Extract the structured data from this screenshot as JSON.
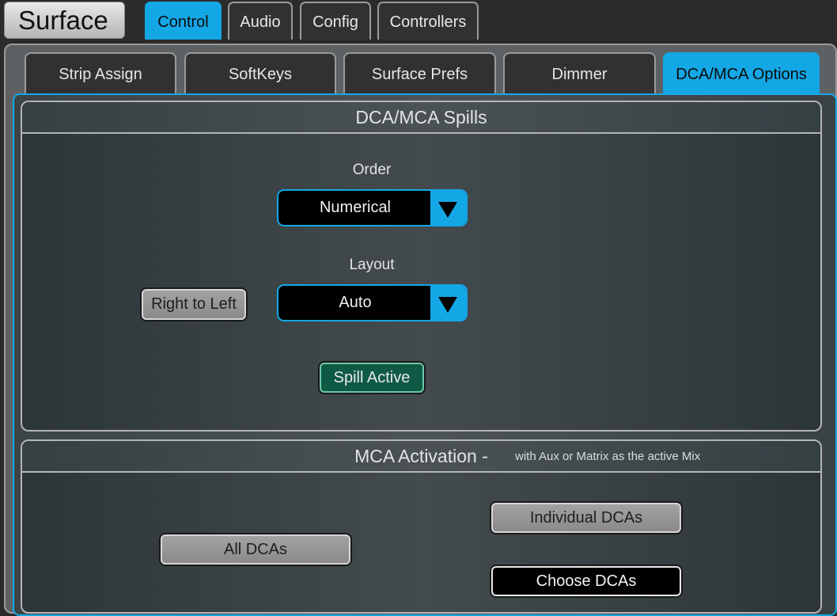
{
  "app": {
    "title": "Surface"
  },
  "top_tabs": [
    {
      "label": "Control",
      "active": true
    },
    {
      "label": "Audio",
      "active": false
    },
    {
      "label": "Config",
      "active": false
    },
    {
      "label": "Controllers",
      "active": false
    }
  ],
  "sub_tabs": [
    {
      "label": "Strip Assign",
      "active": false
    },
    {
      "label": "SoftKeys",
      "active": false
    },
    {
      "label": "Surface Prefs",
      "active": false
    },
    {
      "label": "Dimmer",
      "active": false
    },
    {
      "label": "DCA/MCA Options",
      "active": true
    }
  ],
  "spills": {
    "title": "DCA/MCA Spills",
    "order_label": "Order",
    "order_value": "Numerical",
    "layout_label": "Layout",
    "layout_value": "Auto",
    "direction_button": "Right to Left",
    "spill_active_button": "Spill Active"
  },
  "activation": {
    "title": "MCA Activation -",
    "subtitle": "with Aux or Matrix as the active Mix",
    "all_dcas": "All DCAs",
    "individual_dcas": "Individual DCAs",
    "choose_dcas": "Choose DCAs"
  },
  "colors": {
    "accent": "#14a7e6",
    "spill_active": "#0f5a45"
  }
}
